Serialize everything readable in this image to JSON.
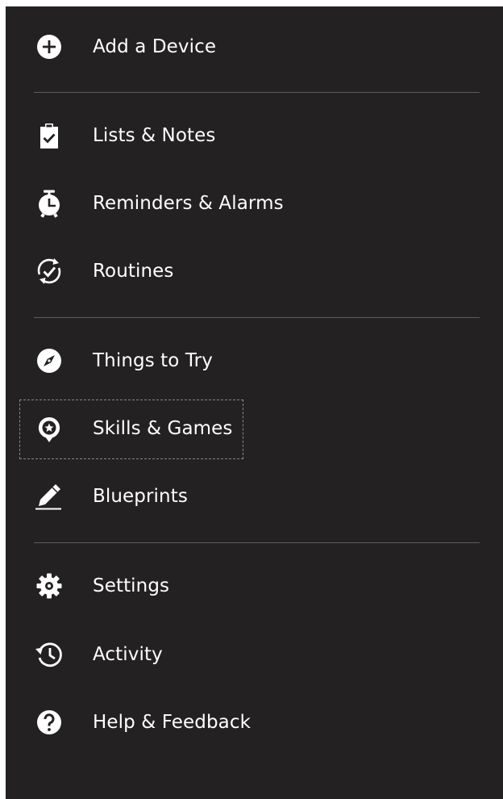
{
  "menu": {
    "items": [
      {
        "label": "Add a Device",
        "icon": "plus-circle-icon"
      },
      {
        "label": "Lists & Notes",
        "icon": "clipboard-check-icon"
      },
      {
        "label": "Reminders & Alarms",
        "icon": "alarm-clock-icon"
      },
      {
        "label": "Routines",
        "icon": "routine-check-icon"
      },
      {
        "label": "Things to Try",
        "icon": "compass-icon"
      },
      {
        "label": "Skills & Games",
        "icon": "skills-star-bubble-icon"
      },
      {
        "label": "Blueprints",
        "icon": "pencil-icon"
      },
      {
        "label": "Settings",
        "icon": "gear-icon"
      },
      {
        "label": "Activity",
        "icon": "history-clock-icon"
      },
      {
        "label": "Help & Feedback",
        "icon": "question-circle-icon"
      }
    ],
    "focused_item": "Skills & Games"
  },
  "colors": {
    "background": "#232122",
    "text": "#ffffff",
    "divider": "#5e5c5d",
    "icon": "#ffffff"
  }
}
